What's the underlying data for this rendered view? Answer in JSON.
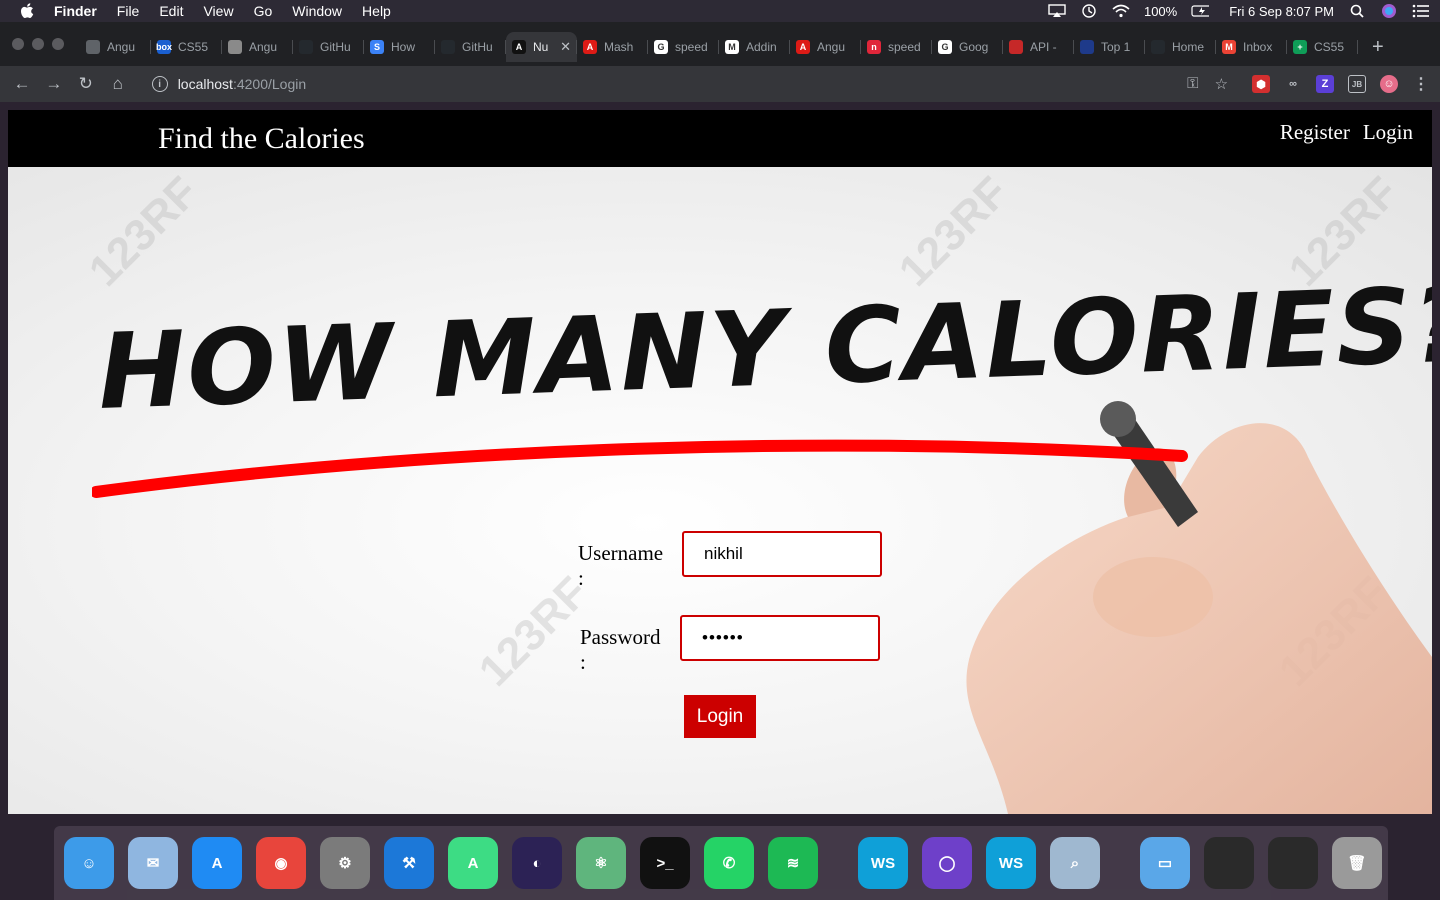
{
  "menubar": {
    "items": [
      "Finder",
      "File",
      "Edit",
      "View",
      "Go",
      "Window",
      "Help"
    ],
    "battery": "100%",
    "datetime": "Fri 6 Sep  8:07 PM"
  },
  "browser": {
    "tabs": [
      {
        "label": "Angu",
        "color": "#5f6368",
        "glyph": ""
      },
      {
        "label": "CS55",
        "color": "#1a5fd0",
        "glyph": "box"
      },
      {
        "label": "Angu",
        "color": "#8a8a8a",
        "glyph": ""
      },
      {
        "label": "GitHu",
        "color": "#24292e",
        "glyph": ""
      },
      {
        "label": "How",
        "color": "#3b82f6",
        "glyph": "S"
      },
      {
        "label": "GitHu",
        "color": "#24292e",
        "glyph": ""
      },
      {
        "label": "Nu",
        "color": "#111111",
        "glyph": "A",
        "active": true
      },
      {
        "label": "Mash",
        "color": "#dd1b16",
        "glyph": "A"
      },
      {
        "label": "speed",
        "color": "#ffffff",
        "glyph": "G"
      },
      {
        "label": "Addin",
        "color": "#ffffff",
        "glyph": "M"
      },
      {
        "label": "Angu",
        "color": "#dd1b16",
        "glyph": "A"
      },
      {
        "label": "speed",
        "color": "#e0263a",
        "glyph": "n"
      },
      {
        "label": "Goog",
        "color": "#ffffff",
        "glyph": "G"
      },
      {
        "label": "API -",
        "color": "#c62828",
        "glyph": ""
      },
      {
        "label": "Top 1",
        "color": "#1e3a8a",
        "glyph": ""
      },
      {
        "label": "Home",
        "color": "#24292e",
        "glyph": ""
      },
      {
        "label": "Inbox",
        "color": "#ea4335",
        "glyph": "M"
      },
      {
        "label": "CS55",
        "color": "#0f9d58",
        "glyph": "+"
      }
    ],
    "url_host": "localhost",
    "url_path": ":4200/Login"
  },
  "app": {
    "brand": "Find the Calories",
    "nav": {
      "register": "Register",
      "login": "Login"
    },
    "hero_title": "HOW MANY CALORIES?",
    "watermark": "123RF",
    "form": {
      "username_label": "Username :",
      "username_value": "nikhil",
      "password_label": "Password :",
      "password_value": "••••••",
      "login_button": "Login"
    }
  },
  "dock": {
    "apps": [
      {
        "name": "finder",
        "color": "#3d9be9",
        "glyph": "☺"
      },
      {
        "name": "mail",
        "color": "#8fb6e0",
        "glyph": "✉"
      },
      {
        "name": "app-store",
        "color": "#1f8bf3",
        "glyph": "A"
      },
      {
        "name": "chrome",
        "color": "#e8453c",
        "glyph": "◉"
      },
      {
        "name": "system-preferences",
        "color": "#7b7b7b",
        "glyph": "⚙"
      },
      {
        "name": "xcode",
        "color": "#1c78d8",
        "glyph": "⚒"
      },
      {
        "name": "android-studio",
        "color": "#3ddc84",
        "glyph": "A"
      },
      {
        "name": "eclipse",
        "color": "#2c2255",
        "glyph": "◐"
      },
      {
        "name": "atom",
        "color": "#5fb57d",
        "glyph": "⚛"
      },
      {
        "name": "terminal",
        "color": "#111111",
        "glyph": ">_"
      },
      {
        "name": "whatsapp",
        "color": "#25d366",
        "glyph": "✆"
      },
      {
        "name": "spotify",
        "color": "#1db954",
        "glyph": "≋"
      },
      {
        "name": "webstorm",
        "color": "#0fa0d8",
        "glyph": "WS"
      },
      {
        "name": "github-desktop",
        "color": "#6e40c9",
        "glyph": "◯"
      },
      {
        "name": "webstorm-2",
        "color": "#0fa0d8",
        "glyph": "WS"
      },
      {
        "name": "preview",
        "color": "#9fb8d0",
        "glyph": "⌕"
      },
      {
        "name": "downloads-folder",
        "color": "#5aa7e8",
        "glyph": "▭"
      },
      {
        "name": "window-1",
        "color": "#2a2a2a",
        "glyph": ""
      },
      {
        "name": "window-2",
        "color": "#2a2a2a",
        "glyph": ""
      },
      {
        "name": "trash",
        "color": "#9a9a9a",
        "glyph": "🗑"
      }
    ]
  }
}
